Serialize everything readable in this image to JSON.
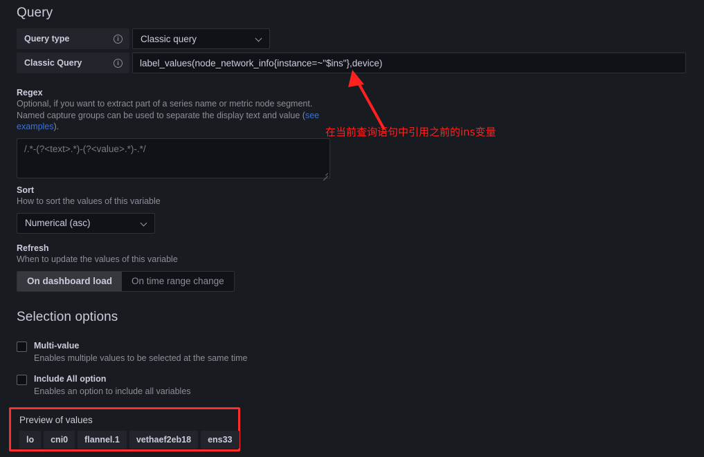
{
  "query_section": {
    "title": "Query",
    "rows": [
      {
        "label": "Query type",
        "info_icon": "info-circle-icon",
        "control": "select",
        "value": "Classic query"
      },
      {
        "label": "Classic Query",
        "info_icon": "info-circle-icon",
        "control": "text",
        "value": "label_values(node_network_info{instance=~\"$ins\"},device)"
      }
    ]
  },
  "regex": {
    "label": "Regex",
    "desc_part1": "Optional, if you want to extract part of a series name or metric node segment. Named capture groups can be used to separate the display text and value (",
    "link_text": "see examples",
    "desc_part2": ").",
    "placeholder": "/.*-(?<text>.*)-(?<value>.*)-.*/",
    "value": ""
  },
  "sort": {
    "label": "Sort",
    "desc": "How to sort the values of this variable",
    "value": "Numerical (asc)"
  },
  "refresh": {
    "label": "Refresh",
    "desc": "When to update the values of this variable",
    "options": [
      "On dashboard load",
      "On time range change"
    ],
    "selected": "On dashboard load"
  },
  "selection_options": {
    "title": "Selection options",
    "items": [
      {
        "title": "Multi-value",
        "desc": "Enables multiple values to be selected at the same time",
        "checked": false
      },
      {
        "title": "Include All option",
        "desc": "Enables an option to include all variables",
        "checked": false
      }
    ]
  },
  "preview": {
    "title": "Preview of values",
    "values": [
      "lo",
      "cni0",
      "flannel.1",
      "vethaef2eb18",
      "ens33"
    ]
  },
  "annotation": {
    "text": "在当前查询语句中引用之前的ins变量",
    "color": "#ff2020"
  },
  "colors": {
    "background": "#181b1f",
    "input_bg": "#111217",
    "label_bg": "#22252b",
    "text": "#ccccdc",
    "muted": "#8e8e9b",
    "link": "#3d71d9",
    "highlight": "#ff2d2d"
  }
}
